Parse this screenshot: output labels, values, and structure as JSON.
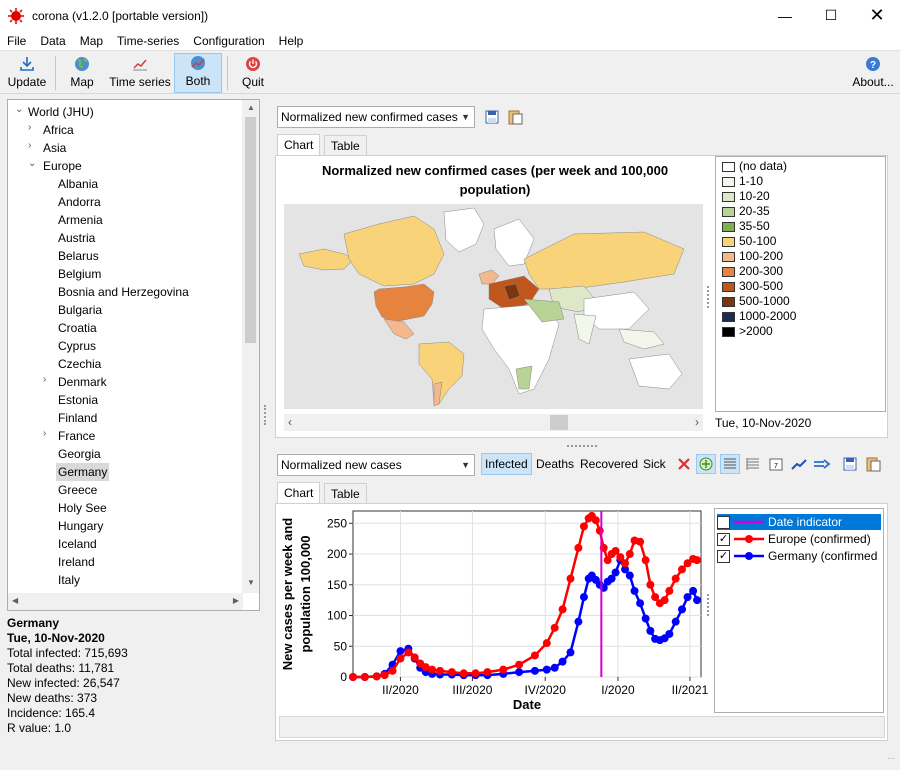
{
  "window": {
    "title": "corona (v1.2.0 [portable version])"
  },
  "menu": [
    "File",
    "Data",
    "Map",
    "Time-series",
    "Configuration",
    "Help"
  ],
  "toolbar": {
    "update": "Update",
    "map": "Map",
    "timeseries": "Time series",
    "both": "Both",
    "quit": "Quit",
    "about": "About..."
  },
  "tree": {
    "root": "World (JHU)",
    "continents": [
      "Africa",
      "Asia",
      "Europe"
    ],
    "countries": [
      "Albania",
      "Andorra",
      "Armenia",
      "Austria",
      "Belarus",
      "Belgium",
      "Bosnia and Herzegovina",
      "Bulgaria",
      "Croatia",
      "Cyprus",
      "Czechia",
      "Denmark",
      "Estonia",
      "Finland",
      "France",
      "Georgia",
      "Germany",
      "Greece",
      "Holy See",
      "Hungary",
      "Iceland",
      "Ireland",
      "Italy"
    ],
    "selected": "Germany"
  },
  "info": {
    "country": "Germany",
    "date": "Tue, 10-Nov-2020",
    "total_infected": "Total infected: 715,693",
    "total_deaths": "Total deaths: 11,781",
    "new_infected": "New infected: 26,547",
    "new_deaths": "New deaths: 373",
    "incidence": "Incidence: 165.4",
    "rvalue": "R value: 1.0"
  },
  "map_panel": {
    "combo": "Normalized new confirmed cases",
    "tab_chart": "Chart",
    "tab_table": "Table",
    "title_line1": "Normalized new confirmed cases (per week and 100,000",
    "title_line2": "population)",
    "date": "Tue, 10-Nov-2020",
    "legend": [
      {
        "label": "(no data)",
        "color": "#ffffff"
      },
      {
        "label": "1-10",
        "color": "#f3f6ea"
      },
      {
        "label": "10-20",
        "color": "#dde8c8"
      },
      {
        "label": "20-35",
        "color": "#b9d296"
      },
      {
        "label": "35-50",
        "color": "#7fb04f"
      },
      {
        "label": "50-100",
        "color": "#f8d37a"
      },
      {
        "label": "100-200",
        "color": "#f3b88b"
      },
      {
        "label": "200-300",
        "color": "#e6833f"
      },
      {
        "label": "300-500",
        "color": "#c0561c"
      },
      {
        "label": "500-1000",
        "color": "#7d3510"
      },
      {
        "label": "1000-2000",
        "color": "#1c2b50"
      },
      {
        "label": ">2000",
        "color": "#000000"
      }
    ]
  },
  "ts_panel": {
    "combo": "Normalized new cases",
    "btn_infected": "Infected",
    "btn_deaths": "Deaths",
    "btn_recovered": "Recovered",
    "btn_sick": "Sick",
    "tab_chart": "Chart",
    "tab_table": "Table",
    "legend": [
      {
        "label": "Date indicator",
        "color": "#d000d0"
      },
      {
        "label": "Europe (confirmed)",
        "color": "#ff0000"
      },
      {
        "label": "Germany (confirmed",
        "color": "#0000ff"
      }
    ]
  },
  "chart_data": {
    "type": "line",
    "xlabel": "Date",
    "ylabel_line1": "New cases per week and",
    "ylabel_line2": "population 100,000",
    "ylim": [
      0,
      270
    ],
    "yticks": [
      0,
      50,
      100,
      150,
      200,
      250
    ],
    "xticks": [
      {
        "label": "II/2020",
        "t": 30
      },
      {
        "label": "III/2020",
        "t": 121
      },
      {
        "label": "IV/2020",
        "t": 213
      },
      {
        "label": "I/2020",
        "t": 305
      },
      {
        "label": "II/2021",
        "t": 396
      }
    ],
    "xlim": [
      -30,
      410
    ],
    "date_indicator_t": 284,
    "series": [
      {
        "name": "Europe (confirmed)",
        "color": "#ff0000",
        "t": [
          -30,
          -15,
          0,
          10,
          20,
          30,
          40,
          48,
          55,
          62,
          70,
          80,
          95,
          110,
          125,
          140,
          160,
          180,
          200,
          215,
          225,
          235,
          245,
          255,
          262,
          268,
          272,
          277,
          282,
          287,
          292,
          297,
          302,
          308,
          314,
          320,
          326,
          333,
          340,
          346,
          352,
          358,
          364,
          370,
          378,
          386,
          393,
          400,
          405
        ],
        "v": [
          0,
          0,
          1,
          3,
          10,
          30,
          40,
          32,
          22,
          16,
          12,
          10,
          8,
          6,
          6,
          8,
          12,
          20,
          35,
          55,
          80,
          110,
          160,
          210,
          245,
          258,
          262,
          255,
          238,
          210,
          190,
          200,
          205,
          195,
          185,
          200,
          222,
          220,
          190,
          150,
          130,
          120,
          125,
          140,
          160,
          175,
          185,
          192,
          190
        ]
      },
      {
        "name": "Germany (confirmed)",
        "color": "#0000ff",
        "t": [
          -30,
          -15,
          0,
          10,
          20,
          30,
          40,
          48,
          55,
          62,
          70,
          80,
          95,
          110,
          125,
          140,
          160,
          180,
          200,
          215,
          225,
          235,
          245,
          255,
          262,
          268,
          272,
          277,
          282,
          287,
          292,
          297,
          302,
          308,
          314,
          320,
          326,
          333,
          340,
          346,
          352,
          358,
          364,
          370,
          378,
          386,
          393,
          400,
          405
        ],
        "v": [
          0,
          0,
          1,
          5,
          20,
          42,
          46,
          30,
          15,
          8,
          5,
          4,
          4,
          3,
          3,
          3,
          5,
          8,
          10,
          12,
          15,
          25,
          40,
          90,
          130,
          160,
          165,
          158,
          150,
          145,
          155,
          160,
          170,
          190,
          175,
          165,
          140,
          120,
          95,
          75,
          62,
          60,
          63,
          70,
          90,
          110,
          130,
          140,
          125
        ]
      }
    ]
  }
}
